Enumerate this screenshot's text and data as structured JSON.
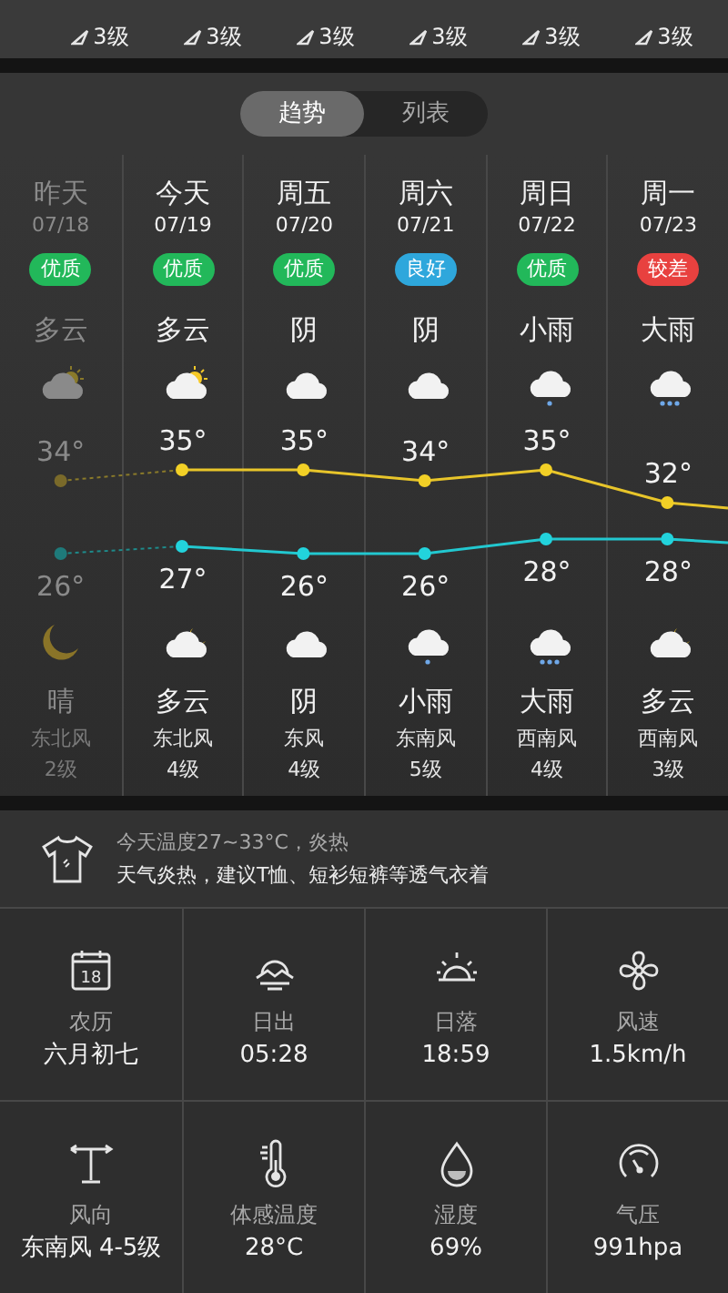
{
  "hourly": [
    {
      "wind": "3级"
    },
    {
      "wind": "3级"
    },
    {
      "wind": "3级"
    },
    {
      "wind": "3级"
    },
    {
      "wind": "3级"
    },
    {
      "wind": "3级"
    }
  ],
  "view_tabs": [
    {
      "label": "趋势",
      "selected": true
    },
    {
      "label": "列表",
      "selected": false
    }
  ],
  "days": [
    {
      "day": "昨天",
      "date": "07/18",
      "aqi": "优质",
      "color": "#22b85a",
      "past": true,
      "day_condition": "多云",
      "day_icon": {
        "kind": "partly-cloudy"
      },
      "high": "34°",
      "low": "26°",
      "night_icon": {
        "kind": "moon"
      },
      "night_condition": "晴",
      "wind_dir": "东北风",
      "wind_level": "2级"
    },
    {
      "day": "今天",
      "date": "07/19",
      "aqi": "优质",
      "color": "#22b85a",
      "past": false,
      "day_condition": "多云",
      "day_icon": {
        "kind": "partly-cloudy"
      },
      "high": "35°",
      "low": "27°",
      "night_icon": {
        "kind": "cloud-moon"
      },
      "night_condition": "多云",
      "wind_dir": "东北风",
      "wind_level": "4级"
    },
    {
      "day": "周五",
      "date": "07/20",
      "aqi": "优质",
      "color": "#22b85a",
      "past": false,
      "day_condition": "阴",
      "day_icon": {
        "kind": "cloud"
      },
      "high": "35°",
      "low": "26°",
      "night_icon": {
        "kind": "cloud"
      },
      "night_condition": "阴",
      "wind_dir": "东风",
      "wind_level": "4级"
    },
    {
      "day": "周六",
      "date": "07/21",
      "aqi": "良好",
      "color": "#2ea7dc",
      "past": false,
      "day_condition": "阴",
      "day_icon": {
        "kind": "cloud"
      },
      "high": "34°",
      "low": "26°",
      "night_icon": {
        "kind": "light-rain"
      },
      "night_condition": "小雨",
      "wind_dir": "东南风",
      "wind_level": "5级"
    },
    {
      "day": "周日",
      "date": "07/22",
      "aqi": "优质",
      "color": "#22b85a",
      "past": false,
      "day_condition": "小雨",
      "day_icon": {
        "kind": "light-rain"
      },
      "high": "35°",
      "low": "28°",
      "night_icon": {
        "kind": "heavy-rain"
      },
      "night_condition": "大雨",
      "wind_dir": "西南风",
      "wind_level": "4级"
    },
    {
      "day": "周一",
      "date": "07/23",
      "aqi": "较差",
      "color": "#e8413f",
      "past": false,
      "day_condition": "大雨",
      "day_icon": {
        "kind": "heavy-rain"
      },
      "high": "32°",
      "low": "28°",
      "night_icon": {
        "kind": "cloud-moon"
      },
      "night_condition": "多云",
      "wind_dir": "西南风",
      "wind_level": "3级"
    }
  ],
  "tip": {
    "title": "今天温度27~33°C，炎热",
    "advice": "天气炎热，建议T恤、短衫短裤等透气衣着"
  },
  "details": [
    {
      "kind": "calendar",
      "icon_text": "18",
      "label": "农历",
      "value": "六月初七"
    },
    {
      "kind": "sunrise",
      "label": "日出",
      "value": "05:28"
    },
    {
      "kind": "sunset",
      "label": "日落",
      "value": "18:59"
    },
    {
      "kind": "fan",
      "label": "风速",
      "value": "1.5km/h"
    },
    {
      "kind": "vane",
      "label": "风向",
      "value": "东南风 4-5级"
    },
    {
      "kind": "thermometer",
      "label": "体感温度",
      "value": "28°C"
    },
    {
      "kind": "drop",
      "label": "湿度",
      "value": "69%"
    },
    {
      "kind": "gauge",
      "label": "气压",
      "value": "991hpa"
    }
  ]
}
